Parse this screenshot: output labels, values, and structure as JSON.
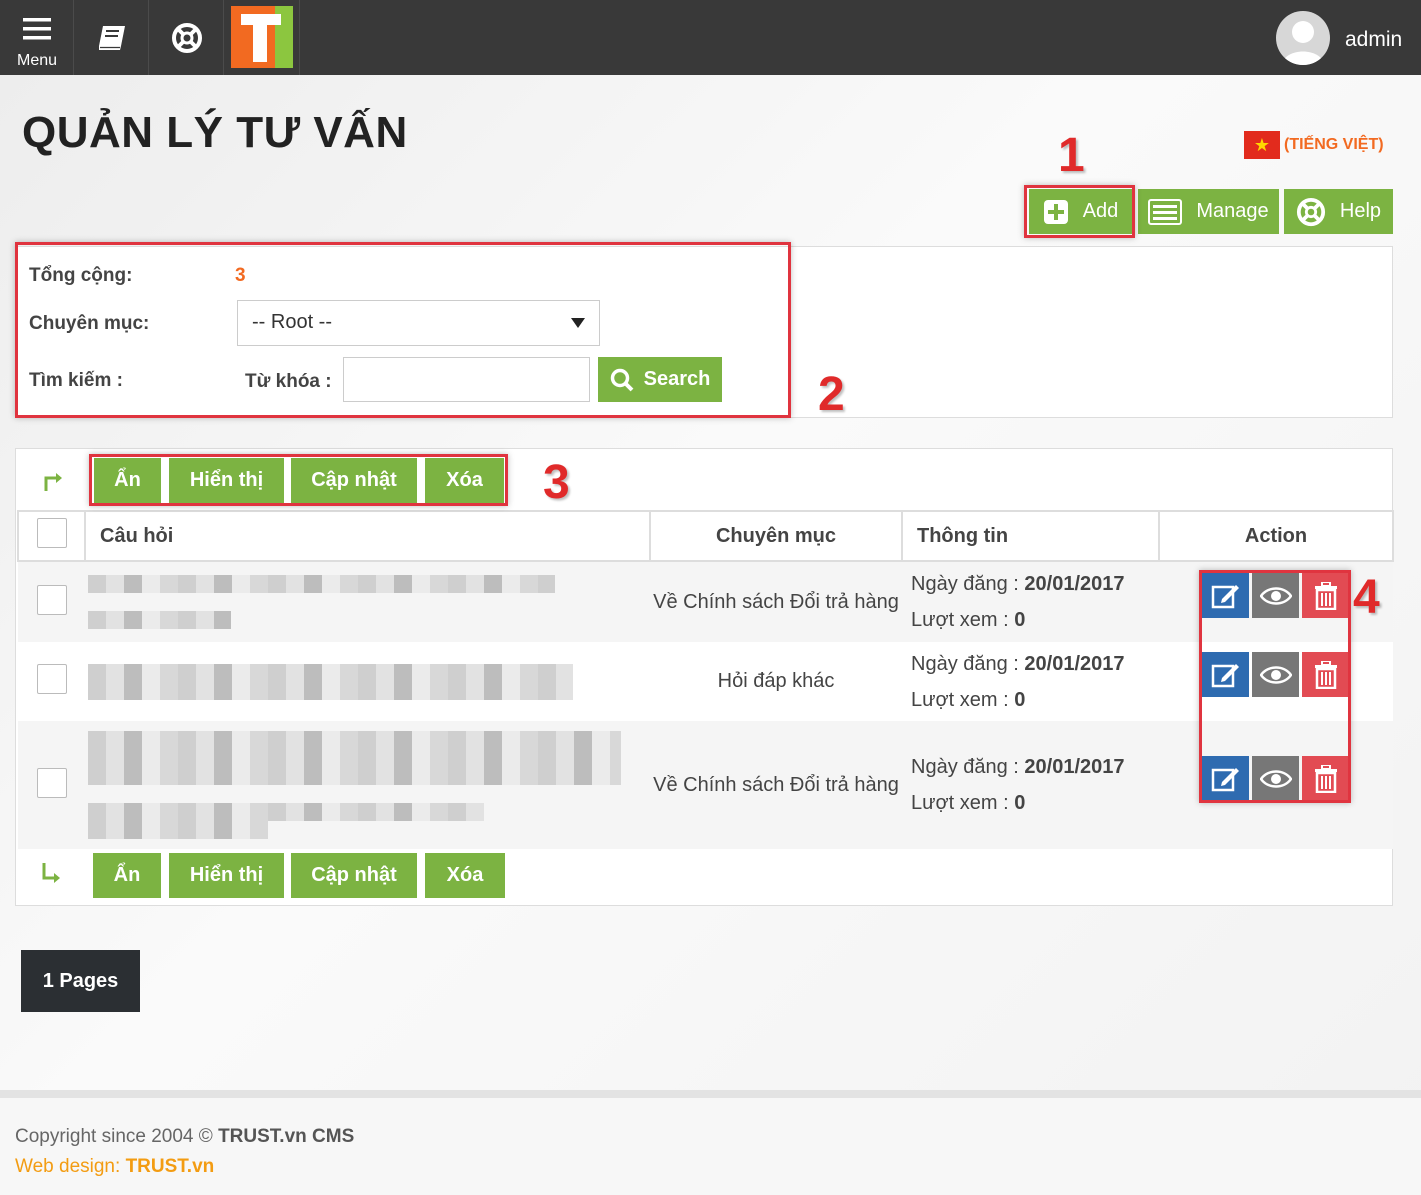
{
  "topbar": {
    "menu_label": "Menu",
    "user_name": "admin",
    "logo_letter": "T"
  },
  "page": {
    "title": "QUẢN LÝ TƯ VẤN",
    "language": "(TIẾNG VIỆT)"
  },
  "toolbar": {
    "add_label": "Add",
    "manage_label": "Manage",
    "help_label": "Help"
  },
  "filter": {
    "total_label": "Tổng cộng:",
    "total_value": "3",
    "category_label": "Chuyên mục:",
    "category_selected": "-- Root --",
    "search_label": "Tìm kiếm :",
    "keyword_label": "Từ khóa :",
    "keyword_value": "",
    "search_button": "Search"
  },
  "bulk_actions": {
    "hide": "Ẩn",
    "show": "Hiển thị",
    "update": "Cập nhật",
    "delete": "Xóa"
  },
  "table": {
    "columns": [
      "Câu hỏi",
      "Chuyên mục",
      "Thông tin",
      "Action"
    ],
    "rows": [
      {
        "category": "Về Chính sách Đổi trả hàng",
        "date_label": "Ngày đăng :",
        "date": "20/01/2017",
        "views_label": "Lượt xem :",
        "views": "0"
      },
      {
        "category": "Hỏi đáp khác",
        "date_label": "Ngày đăng :",
        "date": "20/01/2017",
        "views_label": "Lượt xem :",
        "views": "0"
      },
      {
        "category": "Về Chính sách Đổi trả hàng",
        "date_label": "Ngày đăng :",
        "date": "20/01/2017",
        "views_label": "Lượt xem :",
        "views": "0"
      }
    ]
  },
  "pagination": {
    "label": "1 Pages"
  },
  "annotations": [
    "1",
    "2",
    "3",
    "4"
  ],
  "footer": {
    "copyright_prefix": "Copyright since 2004 ©",
    "copyright_brand": "TRUST.vn CMS",
    "webdesign_prefix": "Web design:",
    "webdesign_brand": "TRUST.vn"
  },
  "colors": {
    "topbar": "#393939",
    "green": "#7cb342",
    "edit_blue": "#2e6bb0",
    "view_gray": "#777777",
    "delete_red": "#e24b53",
    "annotation_red": "#e0343f",
    "accent_orange": "#f26a21"
  },
  "icons": [
    "menu-icon",
    "book-icon",
    "lifebuoy-icon",
    "trust-logo",
    "avatar-icon",
    "flag-icon",
    "plus-icon",
    "list-icon",
    "search-icon",
    "edit-icon",
    "eye-icon",
    "trash-icon",
    "arrow-up-right-icon",
    "arrow-down-right-icon"
  ]
}
